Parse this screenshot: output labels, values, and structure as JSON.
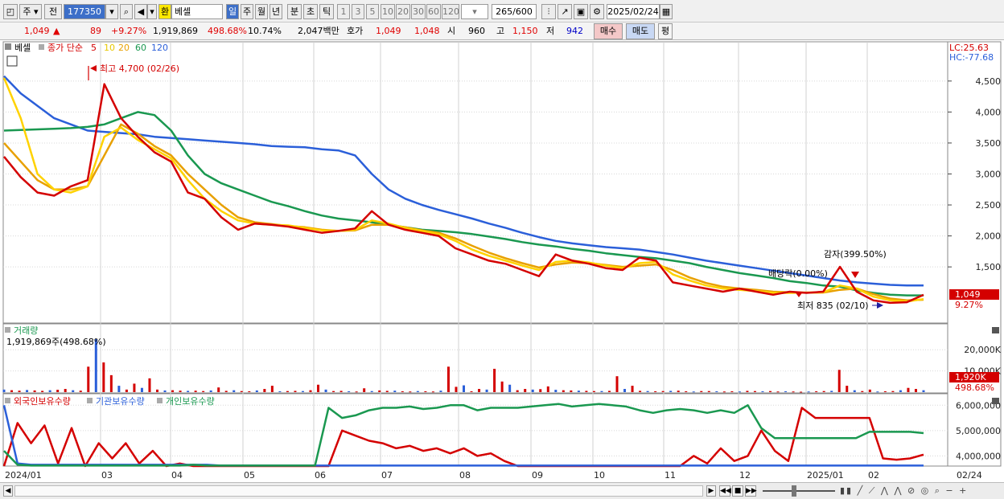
{
  "toolbar": {
    "market": "주",
    "type": "전",
    "code": "177350",
    "currency_badge": "환",
    "stock_name": "베셀",
    "periods": [
      "일",
      "주",
      "월",
      "년",
      "분",
      "초",
      "틱"
    ],
    "minutes": [
      "1",
      "3",
      "5",
      "10",
      "20",
      "30",
      "60",
      "120"
    ],
    "count": "265",
    "count_max": "600",
    "date": "2025/02/24"
  },
  "quote": {
    "price": "1,049",
    "change_arrow": "▲",
    "change": "89",
    "change_pct": "+9.27%",
    "volume": "1,919,869",
    "volume_pct": "498.68%",
    "turnover_pct": "10.74%",
    "amount": "2,047백만",
    "ask_label": "호가",
    "ask": "1,049",
    "bid": "1,048",
    "open_label": "시",
    "open": "960",
    "high_label": "고",
    "high": "1,150",
    "low_label": "저",
    "low": "942",
    "buy_label": "매수",
    "sell_label": "매도",
    "eval_label": "평"
  },
  "price_panel": {
    "legend_name": "베셀",
    "legend_ma_label": "종가 단순",
    "ma_periods": [
      "5",
      "10",
      "20",
      "60",
      "120"
    ],
    "ma_colors": [
      "#d40000",
      "#ffd200",
      "#e8a000",
      "#1a9850",
      "#2b5fd9"
    ],
    "lc_label": "LC:25.63",
    "hc_label": "HC:-77.68",
    "max_annotation": "최고 4,700 (02/26)",
    "min_annotation": "최저 835 (02/10)",
    "event1": "감자(399.50%)",
    "event2": "배당락(0.00%)",
    "current_tag": "1,049",
    "current_pct": "9.27%"
  },
  "volume_panel": {
    "title": "거래량",
    "value_text": "1,919,869주(498.68%)",
    "current_tag": "1,920K",
    "current_pct": "498.68%"
  },
  "holding_panel": {
    "legend": [
      "외국인보유수량",
      "기관보유수량",
      "개인보유수량"
    ],
    "legend_colors": [
      "#d40000",
      "#2b5fd9",
      "#1a9850"
    ]
  },
  "chart_data": [
    {
      "type": "line",
      "title": "베셀",
      "x_labels": [
        "2024/01",
        "03",
        "04",
        "05",
        "06",
        "07",
        "08",
        "09",
        "10",
        "11",
        "12",
        "2025/01",
        "02",
        "02/24"
      ],
      "y_ticks": [
        1500,
        2000,
        2500,
        3000,
        3500,
        4000,
        4500
      ],
      "ylim": [
        620,
        4900
      ],
      "series": [
        {
          "name": "5",
          "color": "#d40000",
          "values": [
            3280,
            2950,
            2700,
            2650,
            2800,
            2900,
            4450,
            3900,
            3600,
            3350,
            3200,
            2700,
            2600,
            2300,
            2100,
            2200,
            2180,
            2150,
            2100,
            2050,
            2080,
            2120,
            2400,
            2180,
            2100,
            2050,
            2000,
            1800,
            1700,
            1600,
            1550,
            1450,
            1350,
            1700,
            1600,
            1550,
            1480,
            1450,
            1650,
            1600,
            1250,
            1200,
            1150,
            1100,
            1150,
            1100,
            1050,
            1100,
            1080,
            1100,
            1500,
            1100,
            960,
            920,
            930,
            1049
          ]
        },
        {
          "name": "10",
          "color": "#ffd200",
          "values": [
            4550,
            3900,
            3000,
            2750,
            2700,
            2800,
            3600,
            3750,
            3550,
            3400,
            3250,
            2900,
            2600,
            2400,
            2250,
            2200,
            2180,
            2170,
            2130,
            2090,
            2080,
            2100,
            2250,
            2200,
            2130,
            2080,
            2030,
            1920,
            1780,
            1680,
            1600,
            1520,
            1450,
            1580,
            1600,
            1570,
            1520,
            1480,
            1560,
            1580,
            1380,
            1280,
            1200,
            1150,
            1130,
            1110,
            1080,
            1080,
            1085,
            1090,
            1200,
            1150,
            1020,
            960,
            940,
            980
          ]
        },
        {
          "name": "20",
          "color": "#e8a000",
          "values": [
            3500,
            3200,
            2900,
            2750,
            2750,
            2800,
            3300,
            3800,
            3650,
            3450,
            3300,
            3000,
            2750,
            2500,
            2300,
            2220,
            2190,
            2160,
            2140,
            2100,
            2080,
            2090,
            2180,
            2180,
            2140,
            2090,
            2050,
            1960,
            1840,
            1730,
            1640,
            1560,
            1490,
            1540,
            1570,
            1560,
            1530,
            1500,
            1520,
            1540,
            1450,
            1330,
            1240,
            1180,
            1150,
            1130,
            1100,
            1090,
            1085,
            1085,
            1130,
            1150,
            1060,
            990,
            960,
            970
          ]
        },
        {
          "name": "60",
          "color": "#1a9850",
          "values": [
            3700,
            3710,
            3720,
            3730,
            3740,
            3760,
            3800,
            3900,
            4000,
            3950,
            3700,
            3300,
            3000,
            2850,
            2750,
            2650,
            2550,
            2480,
            2400,
            2330,
            2280,
            2250,
            2220,
            2180,
            2140,
            2100,
            2080,
            2060,
            2030,
            1990,
            1950,
            1900,
            1860,
            1830,
            1790,
            1760,
            1720,
            1690,
            1660,
            1640,
            1600,
            1560,
            1500,
            1450,
            1400,
            1360,
            1320,
            1270,
            1240,
            1200,
            1180,
            1120,
            1080,
            1050,
            1040,
            1040
          ]
        },
        {
          "name": "120",
          "color": "#2b5fd9",
          "values": [
            4580,
            4300,
            4100,
            3900,
            3800,
            3700,
            3680,
            3660,
            3640,
            3600,
            3580,
            3560,
            3540,
            3520,
            3500,
            3480,
            3450,
            3440,
            3430,
            3400,
            3380,
            3300,
            3000,
            2750,
            2600,
            2500,
            2420,
            2350,
            2280,
            2200,
            2130,
            2050,
            1980,
            1920,
            1880,
            1850,
            1820,
            1800,
            1780,
            1740,
            1700,
            1650,
            1600,
            1560,
            1520,
            1480,
            1440,
            1400,
            1360,
            1320,
            1280,
            1250,
            1230,
            1210,
            1200,
            1200
          ]
        }
      ]
    },
    {
      "type": "bar",
      "title": "거래량",
      "y_ticks": [
        10000,
        20000
      ],
      "y_tick_labels": [
        "10,000K",
        "20,000K"
      ],
      "ylim": [
        0,
        25000
      ],
      "values": [
        1200,
        900,
        700,
        1000,
        800,
        600,
        900,
        1100,
        1500,
        900,
        700,
        12000,
        27000,
        14000,
        8000,
        3000,
        1200,
        4000,
        2000,
        6500,
        1200,
        800,
        900,
        700,
        600,
        700,
        500,
        800,
        2200,
        600,
        900,
        500,
        400,
        800,
        1500,
        3000,
        400,
        500,
        600,
        500,
        900,
        3500,
        1200,
        500,
        600,
        400,
        300,
        1800,
        500,
        800,
        600,
        700,
        400,
        300,
        500,
        400,
        300,
        700,
        12000,
        2500,
        3200,
        400,
        1500,
        1200,
        11000,
        5000,
        3500,
        900,
        1500,
        1200,
        1400,
        2700,
        1100,
        900,
        800,
        700,
        600,
        500,
        500,
        600,
        7500,
        1500,
        3000,
        600,
        500,
        400,
        500,
        600,
        700,
        400,
        300,
        500,
        500,
        400,
        300,
        400,
        300,
        600,
        500,
        400,
        500,
        300,
        400,
        300,
        200,
        300,
        400,
        500,
        600,
        10500,
        3000,
        900,
        500,
        1200,
        300,
        400,
        500,
        900,
        2000,
        1500,
        900
      ]
    },
    {
      "type": "line",
      "title": "외국인보유수량 / 기관보유수량 / 개인보유수량",
      "y_ticks": [
        4000000,
        5000000,
        6000000
      ],
      "y_tick_labels": [
        "4,000,000",
        "5,000,000",
        "6,000,000"
      ],
      "ylim": [
        3600000,
        6200000
      ],
      "series": [
        {
          "name": "외국인보유수량",
          "color": "#d40000",
          "values": [
            3600000,
            5300000,
            4500000,
            5200000,
            3700000,
            5100000,
            3600000,
            4500000,
            3900000,
            4500000,
            3700000,
            4200000,
            3600000,
            3700000,
            3600000,
            3600000,
            3600000,
            3600000,
            3600000,
            3600000,
            3600000,
            3600000,
            3600000,
            3600000,
            3600000,
            5000000,
            4800000,
            4600000,
            4500000,
            4300000,
            4400000,
            4200000,
            4300000,
            4100000,
            4300000,
            4000000,
            4100000,
            3800000,
            3600000,
            3600000,
            3600000,
            3600000,
            3600000,
            3600000,
            3600000,
            3600000,
            3600000,
            3600000,
            3600000,
            3600000,
            3600000,
            4000000,
            3700000,
            4300000,
            3800000,
            4000000,
            5000000,
            4200000,
            3800000,
            5900000,
            5500000,
            5500000,
            5500000,
            5500000,
            5500000,
            3900000,
            3850000,
            3900000,
            4050000
          ]
        },
        {
          "name": "기관보유수량",
          "color": "#2b5fd9",
          "values": [
            6000000,
            3700000,
            3650000,
            3650000,
            3650000,
            3650000,
            3650000,
            3650000,
            3650000,
            3650000,
            3650000,
            3650000,
            3650000,
            3650000,
            3650000,
            3650000,
            3620000,
            3620000,
            3620000,
            3620000,
            3620000,
            3620000,
            3620000,
            3620000,
            3620000,
            3620000,
            3620000,
            3620000,
            3620000,
            3620000,
            3620000,
            3620000,
            3620000,
            3620000,
            3620000,
            3620000,
            3620000,
            3620000,
            3620000,
            3620000,
            3620000,
            3620000,
            3620000,
            3620000,
            3620000,
            3620000,
            3620000,
            3620000,
            3620000,
            3620000,
            3620000,
            3620000,
            3620000,
            3620000,
            3620000,
            3620000,
            3620000,
            3620000,
            3620000,
            3620000,
            3620000,
            3620000,
            3620000,
            3620000,
            3620000,
            3620000,
            3620000,
            3620000,
            3620000
          ]
        },
        {
          "name": "개인보유수량",
          "color": "#1a9850",
          "values": [
            4200000,
            3650000,
            3620000,
            3620000,
            3620000,
            3620000,
            3620000,
            3620000,
            3620000,
            3620000,
            3620000,
            3620000,
            3620000,
            3620000,
            3650000,
            3620000,
            3620000,
            3620000,
            3620000,
            3620000,
            3620000,
            3620000,
            3620000,
            3620000,
            5900000,
            5500000,
            5600000,
            5800000,
            5900000,
            5900000,
            5950000,
            5850000,
            5900000,
            6000000,
            6000000,
            5800000,
            5900000,
            5900000,
            5900000,
            5950000,
            6000000,
            6050000,
            5950000,
            6000000,
            6050000,
            6000000,
            5950000,
            5800000,
            5700000,
            5800000,
            5850000,
            5800000,
            5700000,
            5800000,
            5700000,
            6000000,
            5100000,
            4700000,
            4700000,
            4700000,
            4700000,
            4700000,
            4700000,
            4700000,
            4950000,
            4950000,
            4950000,
            4950000,
            4900000
          ]
        }
      ]
    }
  ]
}
